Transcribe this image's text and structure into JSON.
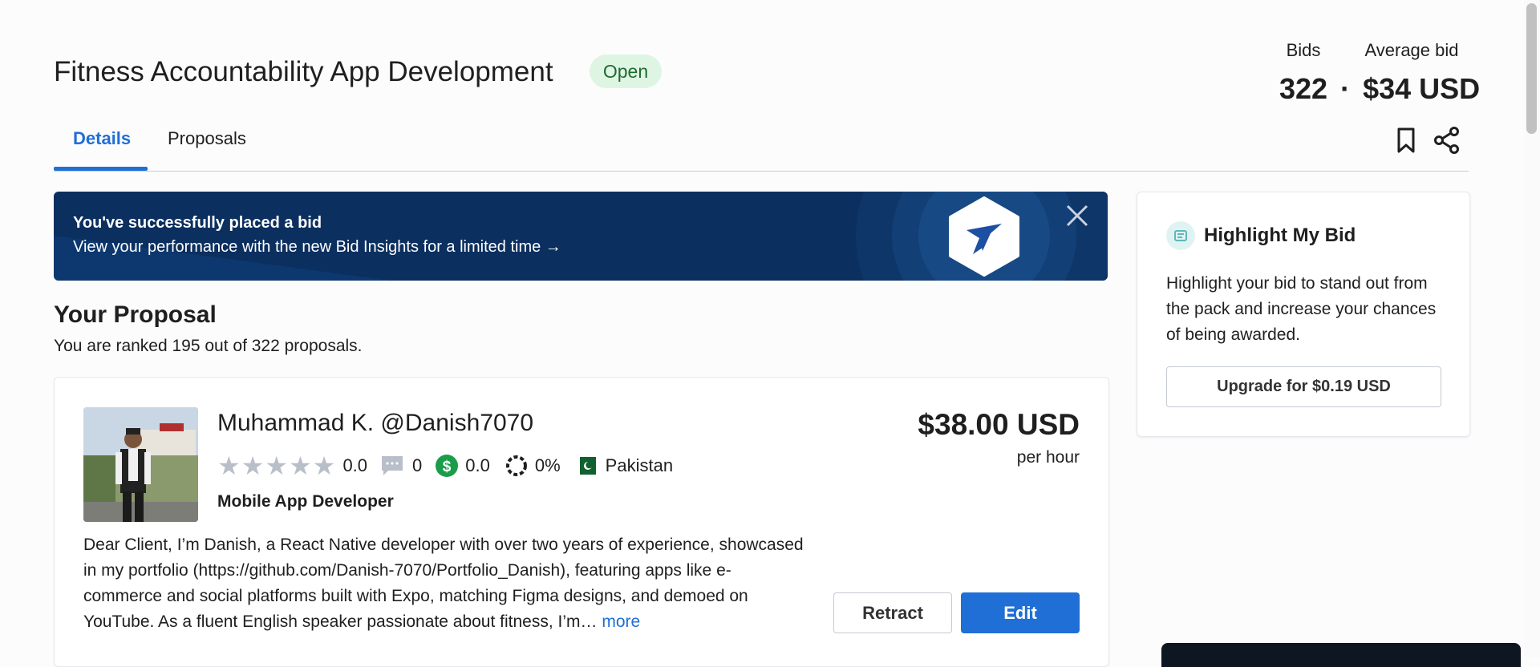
{
  "header": {
    "title": "Fitness Accountability App Development",
    "status": "Open",
    "bids_label": "Bids",
    "avg_label": "Average bid",
    "bids_count": "322",
    "separator": "·",
    "avg_bid": "$34 USD"
  },
  "tabs": [
    {
      "label": "Details",
      "active": true
    },
    {
      "label": "Proposals",
      "active": false
    }
  ],
  "banner": {
    "title": "You've successfully placed a bid",
    "text": "View your performance with the new Bid Insights for a limited time →"
  },
  "proposal_summary": {
    "heading": "Your Proposal",
    "rank_text": "You are ranked 195 out of 322 proposals."
  },
  "proposal": {
    "name": "Muhammad K.",
    "username": "@Danish7070",
    "rating": "0.0",
    "reviews": "0",
    "earnings": "0.0",
    "completion": "0%",
    "country": "Pakistan",
    "title": "Mobile App Developer",
    "amount": "$38.00 USD",
    "rate": "per hour",
    "description": "Dear Client, I’m Danish, a React Native developer with over two years of experience, showcased in my portfolio (https://github.com/Danish-7070/Portfolio_Danish), featuring apps like e-commerce and social platforms built with Expo, matching Figma designs, and demoed on YouTube. As a fluent English speaker passionate about fitness, I’m…",
    "more_label": "more",
    "retract_label": "Retract",
    "edit_label": "Edit"
  },
  "highlight": {
    "title": "Highlight My Bid",
    "text": "Highlight your bid to stand out from the pack and increase your chances of being awarded.",
    "button_label": "Upgrade for $0.19 USD"
  },
  "colors": {
    "accent": "#1f6fd6",
    "banner_bg": "#0b2f5f",
    "open_badge_bg": "#dff5e3",
    "earnings_icon": "#1a9d4a"
  }
}
